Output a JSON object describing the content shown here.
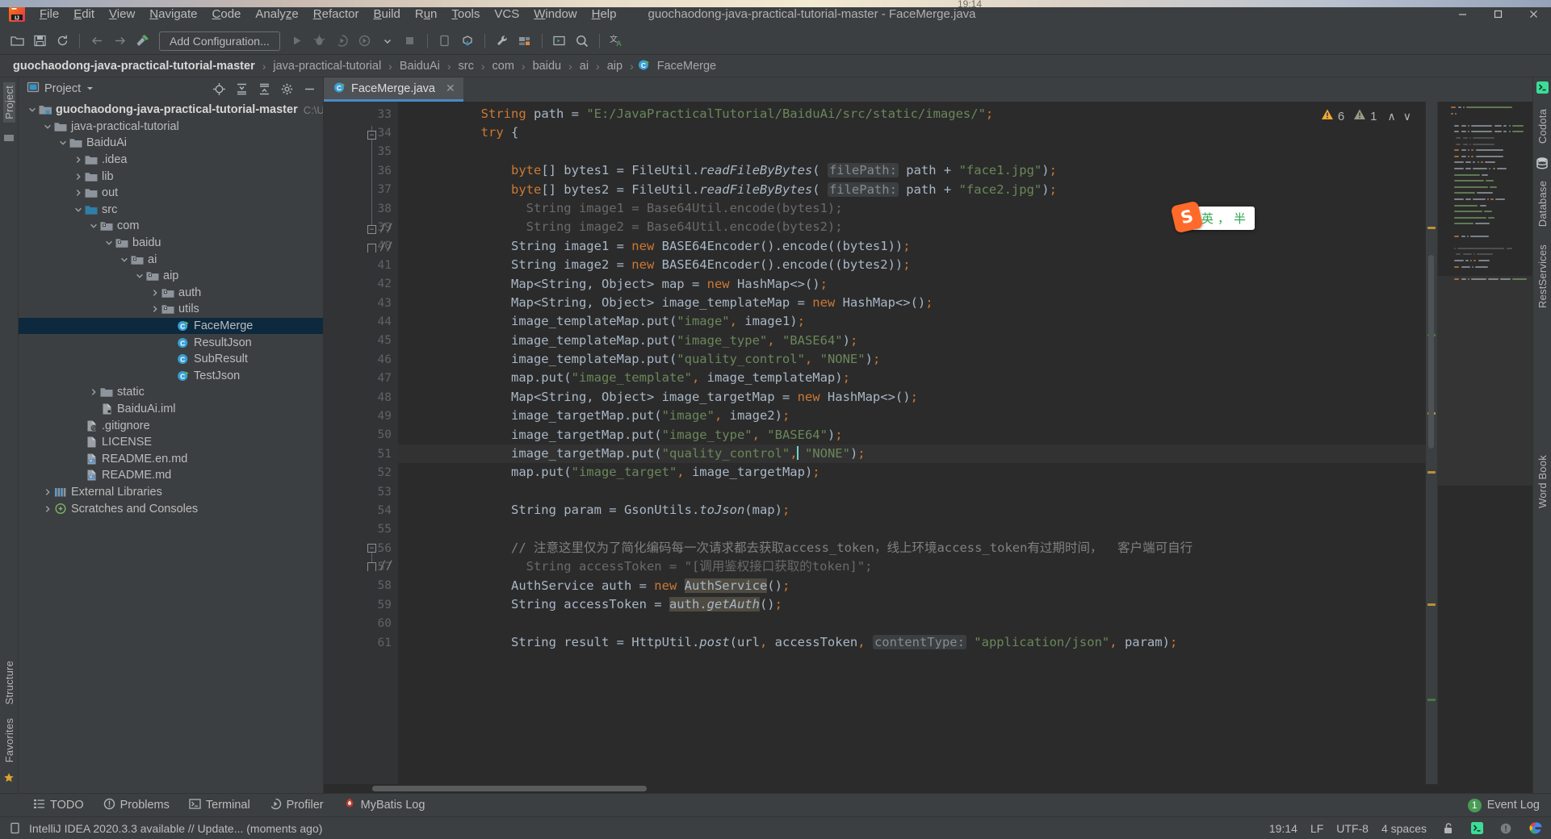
{
  "window": {
    "title": "guochaodong-java-practical-tutorial-master - FaceMerge.java",
    "clock_tiny": "19:14",
    "minimize": "—",
    "maximize": "▢",
    "close": "✕"
  },
  "menubar": {
    "items": [
      {
        "label": "File",
        "mnemonic": "F"
      },
      {
        "label": "Edit",
        "mnemonic": "E"
      },
      {
        "label": "View",
        "mnemonic": "V"
      },
      {
        "label": "Navigate",
        "mnemonic": "N"
      },
      {
        "label": "Code",
        "mnemonic": "C"
      },
      {
        "label": "Analyze",
        "mnemonic": "z"
      },
      {
        "label": "Refactor",
        "mnemonic": "R"
      },
      {
        "label": "Build",
        "mnemonic": "B"
      },
      {
        "label": "Run",
        "mnemonic": "u"
      },
      {
        "label": "Tools",
        "mnemonic": "T"
      },
      {
        "label": "VCS",
        "mnemonic": ""
      },
      {
        "label": "Window",
        "mnemonic": "W"
      },
      {
        "label": "Help",
        "mnemonic": "H"
      }
    ]
  },
  "toolbar": {
    "run_config_label": "Add Configuration...",
    "icons": [
      "open-folder-icon",
      "save-all-icon",
      "sync-icon",
      "back-arrow-icon",
      "forward-arrow-icon",
      "build-hammer-icon",
      "run-icon",
      "debug-icon",
      "run-coverage-icon",
      "profile-icon",
      "dropdown-arrow-icon",
      "stop-icon",
      "device-manager-icon",
      "update-project-icon",
      "settings-wrench-icon",
      "project-structure-icon",
      "terminal-run-icon",
      "search-everywhere-icon",
      "translate-icon"
    ]
  },
  "breadcrumb": {
    "items": [
      "guochaodong-java-practical-tutorial-master",
      "java-practical-tutorial",
      "BaiduAi",
      "src",
      "com",
      "baidu",
      "ai",
      "aip",
      "FaceMerge"
    ],
    "separator": "›"
  },
  "left_stripe": {
    "top": [
      "Project"
    ],
    "bottom": [
      "Structure",
      "Favorites"
    ]
  },
  "right_stripe": {
    "items": [
      "Codota",
      "Database",
      "RestServices",
      "Word Book"
    ]
  },
  "project_panel": {
    "title": "Project",
    "header_icons": [
      "locate-icon",
      "expand-all-icon",
      "collapse-all-icon",
      "gear-icon",
      "hide-icon"
    ],
    "tree": [
      {
        "label": "guochaodong-java-practical-tutorial-master",
        "suffix": "C:\\Users\\",
        "depth": 0,
        "chev": "v",
        "icon": "module-icon",
        "bold": true,
        "selected": false
      },
      {
        "label": "java-practical-tutorial",
        "depth": 1,
        "chev": "v",
        "icon": "folder-icon",
        "bold": false,
        "selected": false
      },
      {
        "label": "BaiduAi",
        "depth": 2,
        "chev": "v",
        "icon": "folder-icon",
        "bold": false,
        "selected": false
      },
      {
        "label": ".idea",
        "depth": 3,
        "chev": ">",
        "icon": "folder-icon",
        "bold": false,
        "selected": false
      },
      {
        "label": "lib",
        "depth": 3,
        "chev": ">",
        "icon": "folder-icon",
        "bold": false,
        "selected": false
      },
      {
        "label": "out",
        "depth": 3,
        "chev": ">",
        "icon": "folder-icon",
        "bold": false,
        "selected": false
      },
      {
        "label": "src",
        "depth": 3,
        "chev": "v",
        "icon": "source-folder-icon",
        "bold": false,
        "selected": false
      },
      {
        "label": "com",
        "depth": 4,
        "chev": "v",
        "icon": "package-icon",
        "bold": false,
        "selected": false
      },
      {
        "label": "baidu",
        "depth": 5,
        "chev": "v",
        "icon": "package-icon",
        "bold": false,
        "selected": false
      },
      {
        "label": "ai",
        "depth": 6,
        "chev": "v",
        "icon": "package-icon",
        "bold": false,
        "selected": false
      },
      {
        "label": "aip",
        "depth": 7,
        "chev": "v",
        "icon": "package-icon",
        "bold": false,
        "selected": false
      },
      {
        "label": "auth",
        "depth": 8,
        "chev": ">",
        "icon": "package-icon",
        "bold": false,
        "selected": false
      },
      {
        "label": "utils",
        "depth": 8,
        "chev": ">",
        "icon": "package-icon",
        "bold": false,
        "selected": false
      },
      {
        "label": "FaceMerge",
        "depth": 9,
        "chev": "",
        "icon": "java-runnable-class-icon",
        "bold": false,
        "selected": true
      },
      {
        "label": "ResultJson",
        "depth": 9,
        "chev": "",
        "icon": "java-class-icon",
        "bold": false,
        "selected": false
      },
      {
        "label": "SubResult",
        "depth": 9,
        "chev": "",
        "icon": "java-class-icon",
        "bold": false,
        "selected": false
      },
      {
        "label": "TestJson",
        "depth": 9,
        "chev": "",
        "icon": "java-runnable-class-icon",
        "bold": false,
        "selected": false
      },
      {
        "label": "static",
        "depth": 4,
        "chev": ">",
        "icon": "folder-icon",
        "bold": false,
        "selected": false
      },
      {
        "label": "BaiduAi.iml",
        "depth": 4,
        "chev": "",
        "icon": "iml-file-icon",
        "bold": false,
        "selected": false
      },
      {
        "label": ".gitignore",
        "depth": 3,
        "chev": "",
        "icon": "gitignore-file-icon",
        "bold": false,
        "selected": false
      },
      {
        "label": "LICENSE",
        "depth": 3,
        "chev": "",
        "icon": "text-file-icon",
        "bold": false,
        "selected": false
      },
      {
        "label": "README.en.md",
        "depth": 3,
        "chev": "",
        "icon": "markdown-file-icon",
        "bold": false,
        "selected": false
      },
      {
        "label": "README.md",
        "depth": 3,
        "chev": "",
        "icon": "markdown-file-icon",
        "bold": false,
        "selected": false
      },
      {
        "label": "External Libraries",
        "depth": 1,
        "chev": ">",
        "icon": "libraries-icon",
        "bold": false,
        "selected": false
      },
      {
        "label": "Scratches and Consoles",
        "depth": 1,
        "chev": ">",
        "icon": "scratches-icon",
        "bold": false,
        "selected": false
      }
    ]
  },
  "editor": {
    "tab": {
      "label": "FaceMerge.java",
      "icon": "java-runnable-class-icon",
      "close": "✕"
    },
    "inspections": {
      "warnings": "6",
      "weak_warnings": "1",
      "up": "∧",
      "down": "∨"
    },
    "first_line_number": 33,
    "lines": [
      {
        "n": 33,
        "html": "        <span class='kw'>String</span> path = <span class='str'>\"E:/JavaPracticalTutorial/BaiduAi/src/static/images/\"</span><span class='kw'>;</span>"
      },
      {
        "n": 34,
        "html": "        <span class='kw'>try</span> {"
      },
      {
        "n": 35,
        "html": ""
      },
      {
        "n": 36,
        "html": "            <span class='kw'>byte</span>[] bytes1 = FileUtil.<span class='ital'>readFileByBytes</span>( <span class='param-hint'>filePath:</span> path + <span class='str'>\"face1.jpg\"</span>)<span class='kw'>;</span>"
      },
      {
        "n": 37,
        "html": "            <span class='kw'>byte</span>[] bytes2 = FileUtil.<span class='ital'>readFileByBytes</span>( <span class='param-hint'>filePath:</span> path + <span class='str'>\"face2.jpg\"</span>)<span class='kw'>;</span>"
      },
      {
        "n": 38,
        "html": "<span class='greyed'>              String image1 = Base64Util.encode(bytes1);</span>"
      },
      {
        "n": 39,
        "html": "<span class='greyed'>              String image2 = Base64Util.encode(bytes2);</span>"
      },
      {
        "n": 40,
        "html": "            String image1 = <span class='kw'>new</span> BASE64Encoder().encode((bytes1))<span class='kw'>;</span>"
      },
      {
        "n": 41,
        "html": "            String image2 = <span class='kw'>new</span> BASE64Encoder().encode((bytes2))<span class='kw'>;</span>"
      },
      {
        "n": 42,
        "html": "            Map&lt;String, Object&gt; map = <span class='kw'>new</span> HashMap&lt;&gt;()<span class='kw'>;</span>"
      },
      {
        "n": 43,
        "html": "            Map&lt;String, Object&gt; image_templateMap = <span class='kw'>new</span> HashMap&lt;&gt;()<span class='kw'>;</span>"
      },
      {
        "n": 44,
        "html": "            image_templateMap.put(<span class='str'>\"image\"</span><span class='kw'>,</span> image1)<span class='kw'>;</span>"
      },
      {
        "n": 45,
        "html": "            image_templateMap.put(<span class='str'>\"image_type\"</span><span class='kw'>,</span> <span class='str'>\"BASE64\"</span>)<span class='kw'>;</span>"
      },
      {
        "n": 46,
        "html": "            image_templateMap.put(<span class='str'>\"quality_control\"</span><span class='kw'>,</span> <span class='str'>\"NONE\"</span>)<span class='kw'>;</span>"
      },
      {
        "n": 47,
        "html": "            map.put(<span class='str'>\"image_template\"</span><span class='kw'>,</span> image_templateMap)<span class='kw'>;</span>"
      },
      {
        "n": 48,
        "html": "            Map&lt;String, Object&gt; image_targetMap = <span class='kw'>new</span> HashMap&lt;&gt;()<span class='kw'>;</span>"
      },
      {
        "n": 49,
        "html": "            image_targetMap.put(<span class='str'>\"image\"</span><span class='kw'>,</span> image2)<span class='kw'>;</span>"
      },
      {
        "n": 50,
        "html": "            image_targetMap.put(<span class='str'>\"image_type\"</span><span class='kw'>,</span> <span class='str'>\"BASE64\"</span>)<span class='kw'>;</span>"
      },
      {
        "n": 51,
        "html": "            image_targetMap.put(<span class='str'>\"quality_control\"</span><span class='kw'>,</span><span class='caret'></span> <span class='str'>\"NONE\"</span>)<span class='kw'>;</span>",
        "caret": true
      },
      {
        "n": 52,
        "html": "            map.put(<span class='str'>\"image_target\"</span><span class='kw'>,</span> image_targetMap)<span class='kw'>;</span>"
      },
      {
        "n": 53,
        "html": ""
      },
      {
        "n": 54,
        "html": "            String param = GsonUtils.<span class='ital'>toJson</span>(map)<span class='kw'>;</span>"
      },
      {
        "n": 55,
        "html": ""
      },
      {
        "n": 56,
        "html": "            <span class='cmt'>// 注意这里仅为了简化编码每一次请求都去获取access_token，线上环境access_token有过期时间，  客户端可自行</span>"
      },
      {
        "n": 57,
        "html": "<span class='greyed'>              String accessToken = \"[调用鉴权接口获取的token]\";</span>"
      },
      {
        "n": 58,
        "html": "            AuthService auth = <span class='kw'>new</span> <span class='hl-ident'>AuthService</span>()<span class='kw'>;</span>"
      },
      {
        "n": 59,
        "html": "            String accessToken = <span class='hl-ident'>auth.<span class='ital'>getAuth</span></span>()<span class='kw'>;</span>"
      },
      {
        "n": 60,
        "html": ""
      },
      {
        "n": 61,
        "html": "            String result = HttpUtil.<span class='ital'>post</span>(url<span class='kw'>,</span> accessToken<span class='kw'>,</span> <span class='param-hint'>contentType:</span> <span class='str'>\"application/json\"</span><span class='kw'>,</span> param)<span class='kw'>;</span>"
      }
    ]
  },
  "ime": {
    "logo": "S",
    "mode": "英",
    "punct": "，",
    "shape": "半"
  },
  "bottom_bar": {
    "windows": [
      {
        "label": "TODO",
        "icon": "todo-icon"
      },
      {
        "label": "Problems",
        "icon": "problems-icon"
      },
      {
        "label": "Terminal",
        "icon": "terminal-icon"
      },
      {
        "label": "Profiler",
        "icon": "profiler-icon"
      },
      {
        "label": "MyBatis Log",
        "icon": "mybatis-icon"
      }
    ],
    "event_log": {
      "label": "Event Log",
      "count": "1"
    }
  },
  "statusbar": {
    "message": "IntelliJ IDEA 2020.3.3 available // Update... (moments ago)",
    "message_icon": "ide-update-icon",
    "right": {
      "position": "19:14",
      "line_separator": "LF",
      "encoding": "UTF-8",
      "indent": "4 spaces",
      "icons": [
        "lock-open-icon",
        "terminal-green-icon",
        "notification-icon",
        "google-icon"
      ]
    }
  },
  "colors": {
    "accent_blue": "#4a88c7",
    "selection": "#0d293e",
    "panel_bg": "#3c3f41",
    "editor_bg": "#2b2b2b",
    "gutter_bg": "#313335",
    "string_green": "#6a8759",
    "keyword_orange": "#cc7832",
    "warning_yellow": "#f0a732",
    "ime_orange": "#ff6a2b"
  }
}
